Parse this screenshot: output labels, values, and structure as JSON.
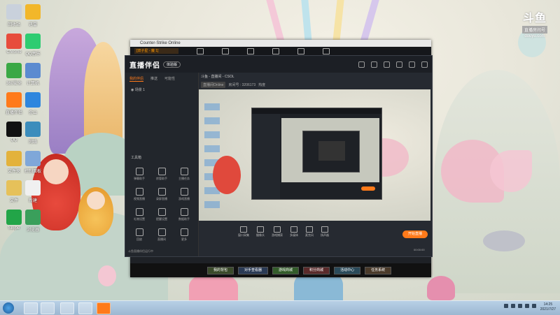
{
  "desktop": {
    "icons": [
      {
        "label": "回收站",
        "color": "#c9d1dc"
      },
      {
        "label": "迅雷",
        "color": "#f2b72a"
      },
      {
        "label": "Chrome",
        "color": "#e74c3c"
      },
      {
        "label": "QQ音乐",
        "color": "#2ecc71"
      },
      {
        "label": "360安全",
        "color": "#3aa845"
      },
      {
        "label": "计算机",
        "color": "#5b8bd0"
      },
      {
        "label": "直播伴侣",
        "color": "#ff7a1a"
      },
      {
        "label": "金山",
        "color": "#2e86de"
      },
      {
        "label": "QQ",
        "color": "#111111"
      },
      {
        "label": "网络",
        "color": "#3c8dbc"
      },
      {
        "label": "文件夹",
        "color": "#e3b23c"
      },
      {
        "label": "控制面板",
        "color": "#7fa7d9"
      },
      {
        "label": "文件",
        "color": "#e6c15a"
      },
      {
        "label": "新建",
        "color": "#f0f0f0"
      },
      {
        "label": "Skype",
        "color": "#22a548"
      },
      {
        "label": "浏览器",
        "color": "#3a9f5b"
      }
    ],
    "watermark": {
      "logo": "斗鱼",
      "room": "直播房间号",
      "url": "douyu.com"
    }
  },
  "game_window": {
    "title": "Counter-Strike Online",
    "tab": "[双子星 - 魔 1]",
    "bottom_buttons": [
      "我的背包",
      "对手查看器",
      "游戏商城",
      "积分商城",
      "活动中心",
      "任务系统"
    ]
  },
  "app": {
    "logo": "直播伴侣",
    "version": "体验版",
    "left_tabs": [
      "我的伴侣",
      "推送",
      "可能性"
    ],
    "scene": "场景 1",
    "tools_title": "工具箱",
    "tools": [
      {
        "label": "弹幕助手"
      },
      {
        "label": "房管助手"
      },
      {
        "label": "主播任务"
      },
      {
        "label": "视频直播"
      },
      {
        "label": "录屏直播"
      },
      {
        "label": "游戏直播"
      },
      {
        "label": "礼物设置"
      },
      {
        "label": "提醒设置"
      },
      {
        "label": "数据助手"
      },
      {
        "label": "回放"
      },
      {
        "label": "直播间"
      },
      {
        "label": "更多"
      }
    ],
    "room_title": "斗鱼 - 直播间 - CSOL",
    "room_tags": [
      "直播间Online",
      "房间号 : 3206173",
      "热度"
    ],
    "controls": [
      {
        "label": "窗口采集"
      },
      {
        "label": "摄像头"
      },
      {
        "label": "游戏捕获"
      },
      {
        "label": "多媒体"
      },
      {
        "label": "麦克风"
      },
      {
        "label": "扬声器"
      }
    ],
    "start_button": "开始直播",
    "timer": "00:00:00",
    "footer_note": "斗鱼直播伴侣运行中"
  },
  "taskbar": {
    "time": "14:25",
    "date": "2021/7/27"
  }
}
